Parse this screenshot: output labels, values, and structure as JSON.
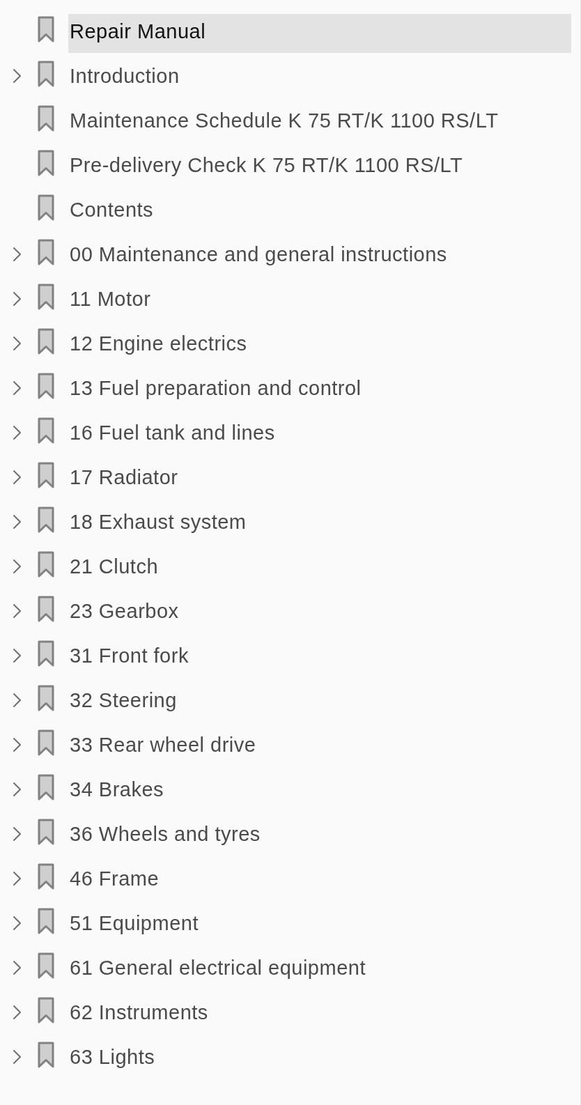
{
  "bookmarks": [
    {
      "label": "Repair Manual",
      "selected": true,
      "expandable": false
    },
    {
      "label": "Introduction",
      "selected": false,
      "expandable": true,
      "expanded": false
    },
    {
      "label": "Maintenance Schedule K 75 RT/K 1100 RS/LT",
      "selected": false,
      "expandable": false
    },
    {
      "label": "Pre-delivery Check K 75 RT/K 1100 RS/LT",
      "selected": false,
      "expandable": false
    },
    {
      "label": "Contents",
      "selected": false,
      "expandable": false
    },
    {
      "label": "00 Maintenance and general instructions",
      "selected": false,
      "expandable": true,
      "expanded": false
    },
    {
      "label": "11 Motor",
      "selected": false,
      "expandable": true,
      "expanded": false
    },
    {
      "label": "12 Engine electrics",
      "selected": false,
      "expandable": true,
      "expanded": false
    },
    {
      "label": "13 Fuel preparation and control",
      "selected": false,
      "expandable": true,
      "expanded": false
    },
    {
      "label": "16 Fuel tank and lines",
      "selected": false,
      "expandable": true,
      "expanded": false
    },
    {
      "label": "17 Radiator",
      "selected": false,
      "expandable": true,
      "expanded": false
    },
    {
      "label": "18 Exhaust system",
      "selected": false,
      "expandable": true,
      "expanded": false
    },
    {
      "label": "21 Clutch",
      "selected": false,
      "expandable": true,
      "expanded": false
    },
    {
      "label": "23 Gearbox",
      "selected": false,
      "expandable": true,
      "expanded": false
    },
    {
      "label": "31 Front fork",
      "selected": false,
      "expandable": true,
      "expanded": false
    },
    {
      "label": "32 Steering",
      "selected": false,
      "expandable": true,
      "expanded": false
    },
    {
      "label": "33 Rear wheel drive",
      "selected": false,
      "expandable": true,
      "expanded": false
    },
    {
      "label": "34 Brakes",
      "selected": false,
      "expandable": true,
      "expanded": false
    },
    {
      "label": "36 Wheels and tyres",
      "selected": false,
      "expandable": true,
      "expanded": false
    },
    {
      "label": "46 Frame",
      "selected": false,
      "expandable": true,
      "expanded": false
    },
    {
      "label": "51 Equipment",
      "selected": false,
      "expandable": true,
      "expanded": false
    },
    {
      "label": "61 General electrical equipment",
      "selected": false,
      "expandable": true,
      "expanded": false
    },
    {
      "label": "62 Instruments",
      "selected": false,
      "expandable": true,
      "expanded": false
    },
    {
      "label": "63 Lights",
      "selected": false,
      "expandable": true,
      "expanded": false
    }
  ]
}
